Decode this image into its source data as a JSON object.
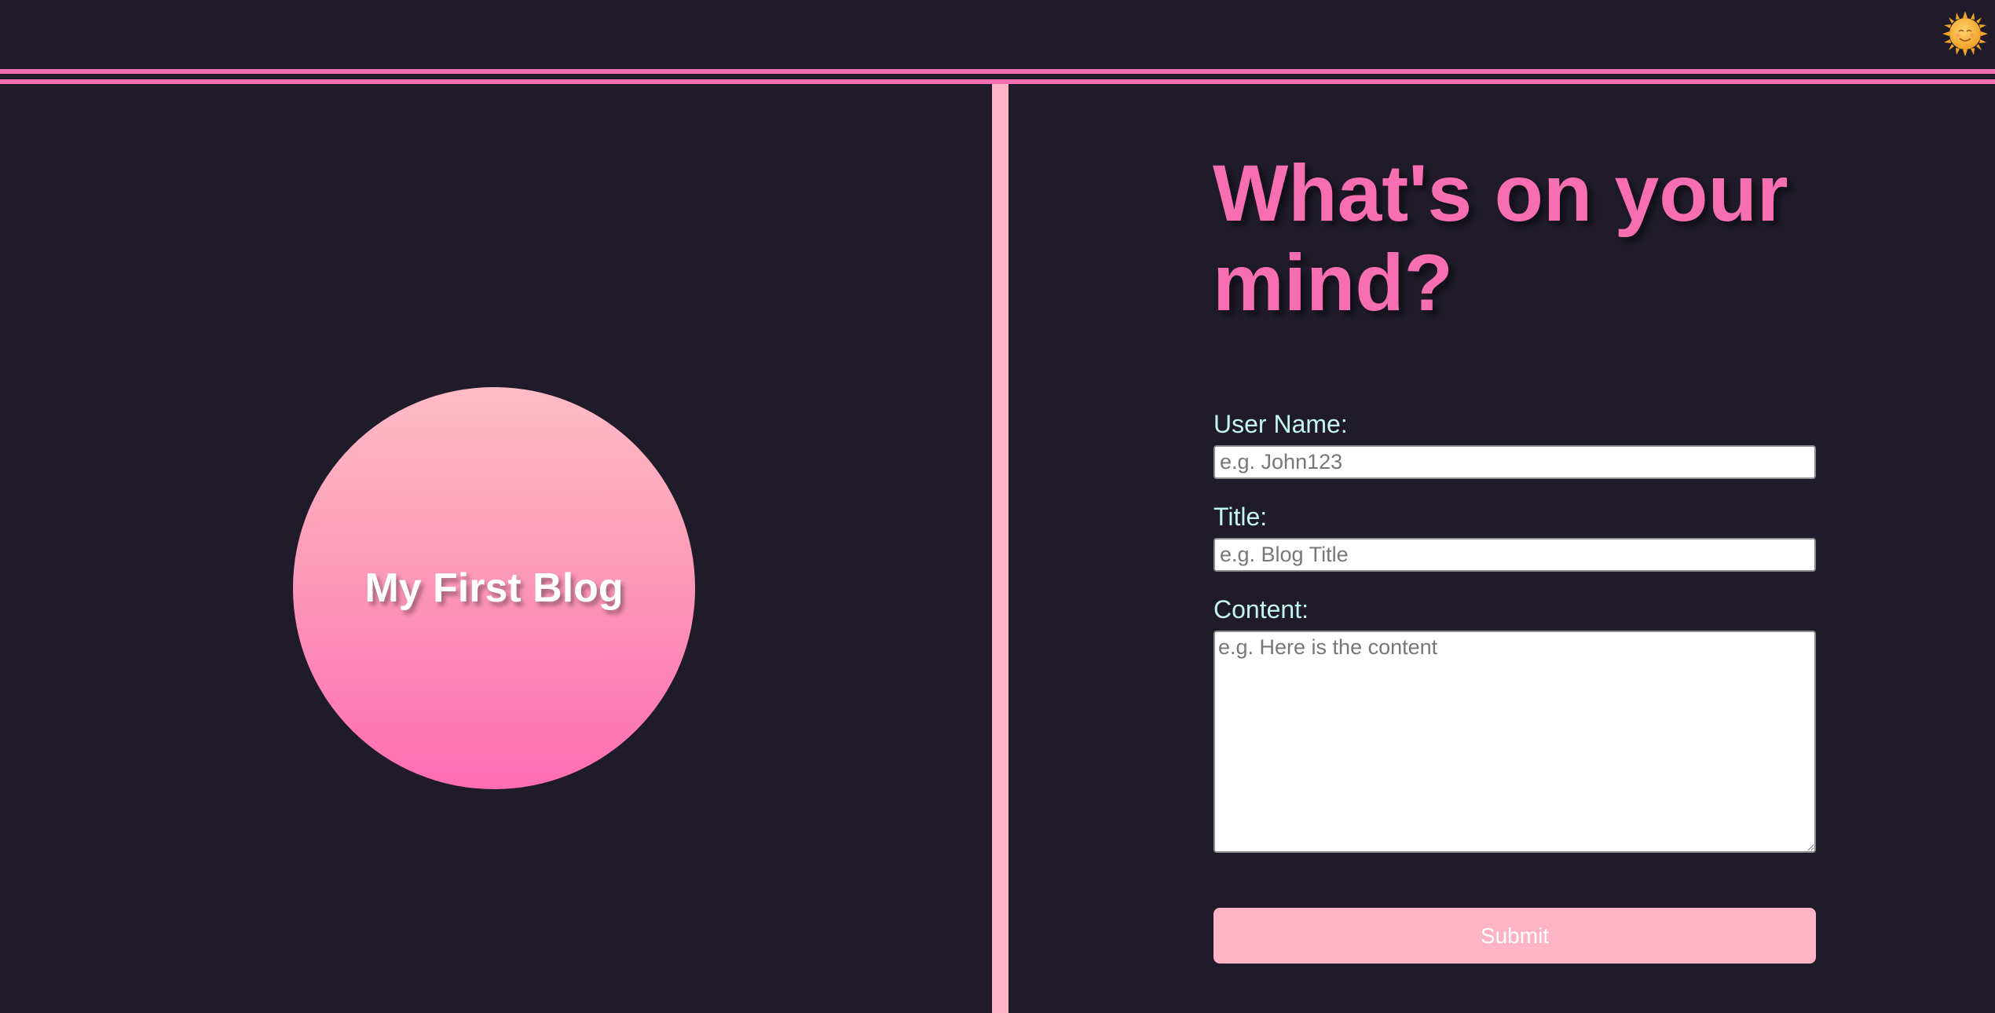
{
  "header": {
    "theme_toggle_icon": "sun-icon"
  },
  "hero": {
    "title": "My First Blog"
  },
  "form": {
    "heading": "What's on your mind?",
    "username_label": "User Name:",
    "username_placeholder": "e.g. John123",
    "title_label": "Title:",
    "title_placeholder": "e.g. Blog Title",
    "content_label": "Content:",
    "content_placeholder": "e.g. Here is the content",
    "submit_label": "Submit"
  },
  "colors": {
    "background": "#1f1b28",
    "accent_pink": "#f76fb2",
    "divider_pink": "#ffb3c5",
    "label_cyan": "#c4f5f3",
    "button_pink": "#feb4c4"
  }
}
